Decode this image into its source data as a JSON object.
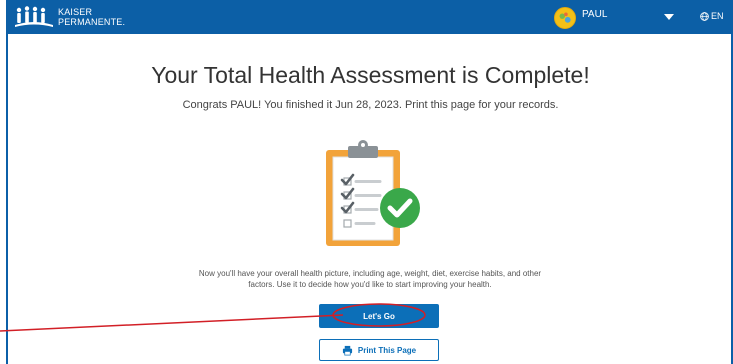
{
  "header": {
    "logo_line1": "KAISER",
    "logo_line2": "PERMANENTE.",
    "user_name": "PAUL",
    "language": "EN",
    "icons": [
      "kaiser-logo-icon",
      "avatar",
      "chevron-down-icon",
      "globe-icon"
    ]
  },
  "main": {
    "title": "Your Total Health Assessment is Complete!",
    "subtitle": "Congrats PAUL! You finished it Jun 28, 2023. Print this page for your records.",
    "description": "Now you'll have your overall health picture, including age, weight, diet, exercise habits, and other factors. Use it to decide how you'd like to start improving your health.",
    "illustration": "clipboard-checklist-icon"
  },
  "actions": {
    "primary_label": "Let's Go",
    "secondary_label": "Print This Page",
    "secondary_icon": "printer-icon"
  },
  "colors": {
    "brand_blue": "#0c5fa6",
    "button_blue": "#0c6fb8",
    "check_green": "#3aa84a",
    "annotation_red": "#d21f26",
    "avatar_yellow": "#f3c018"
  }
}
